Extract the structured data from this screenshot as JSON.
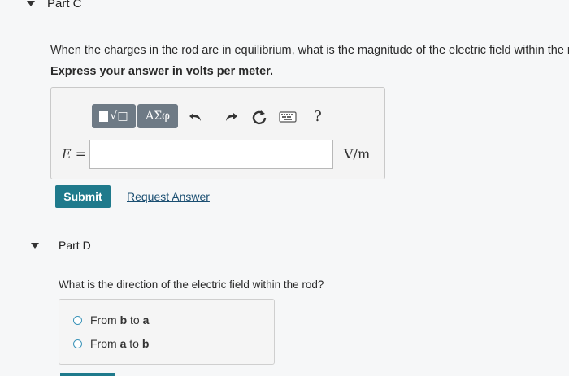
{
  "partC": {
    "title": "Part C",
    "question": "When the charges in the rod are in equilibrium, what is the magnitude of the electric field within the rod?",
    "instruction": "Express your answer in volts per meter.",
    "toolbar": {
      "template_label": "√□",
      "greek_label": "ΑΣφ",
      "help_label": "?"
    },
    "variable_label": "E =",
    "answer_value": "",
    "unit": "V/m",
    "submit_label": "Submit",
    "request_answer_label": "Request Answer"
  },
  "partD": {
    "title": "Part D",
    "question": "What is the direction of the electric field within the rod?",
    "options": [
      {
        "label_prefix": "From ",
        "label_main": "b",
        "label_mid": " to ",
        "label_end": "a"
      },
      {
        "label_prefix": "From ",
        "label_main": "a",
        "label_mid": " to ",
        "label_end": "b"
      }
    ]
  }
}
